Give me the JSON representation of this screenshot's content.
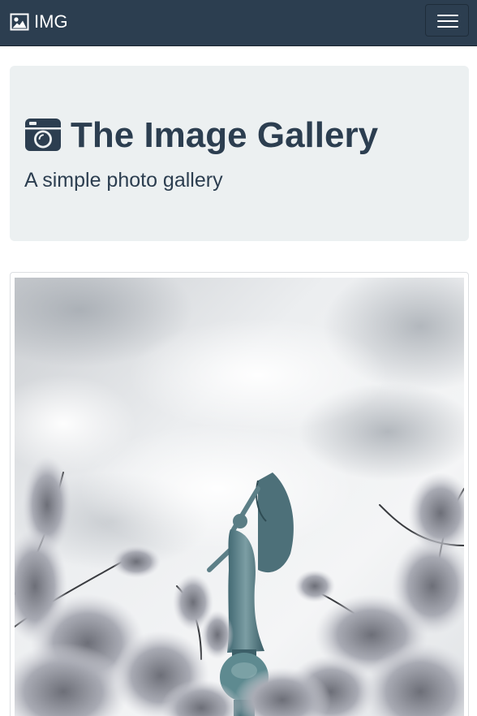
{
  "navbar": {
    "brand_icon": "image-icon",
    "brand_text": "IMG",
    "toggler_icon": "hamburger-menu-icon"
  },
  "jumbotron": {
    "title_icon": "camera-icon",
    "title": "The Image Gallery",
    "subtitle": "A simple photo gallery"
  },
  "colors": {
    "navbar_bg": "#2c3e50",
    "jumbotron_bg": "#ecf0f1",
    "text": "#2c3e50"
  }
}
